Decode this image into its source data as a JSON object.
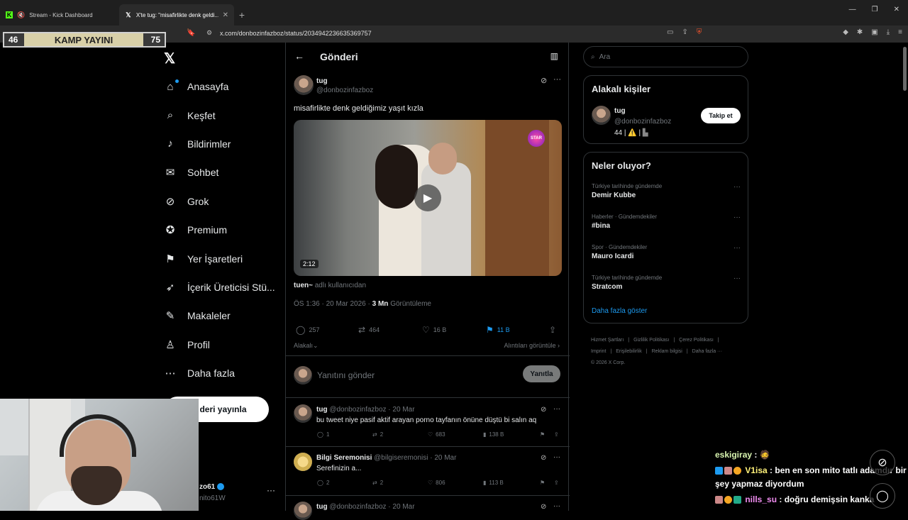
{
  "browser": {
    "tabs": [
      {
        "label": "Stream - Kick Dashboard",
        "active": false
      },
      {
        "label": "X'te tug: \"misafirlikte denk geldi...",
        "active": true
      }
    ],
    "url": "x.com/donbozinfazboz/status/2034942236635369757"
  },
  "overlay": {
    "left": "46",
    "title": "KAMP YAYINI",
    "right": "75"
  },
  "nav": {
    "items": [
      {
        "label": "Anasayfa",
        "icon": "home-icon"
      },
      {
        "label": "Keşfet",
        "icon": "search-icon"
      },
      {
        "label": "Bildirimler",
        "icon": "bell-icon"
      },
      {
        "label": "Sohbet",
        "icon": "mail-icon"
      },
      {
        "label": "Grok",
        "icon": "grok-icon"
      },
      {
        "label": "Premium",
        "icon": "premium-icon"
      },
      {
        "label": "Yer İşaretleri",
        "icon": "bookmark-icon"
      },
      {
        "label": "İçerik Üreticisi Stü...",
        "icon": "rocket-icon"
      },
      {
        "label": "Makaleler",
        "icon": "article-icon"
      },
      {
        "label": "Profil",
        "icon": "user-icon"
      },
      {
        "label": "Daha fazla",
        "icon": "more-icon"
      }
    ],
    "post_button": "deri yayınla",
    "account_name": "zo61",
    "account_handle": "nito61W"
  },
  "main": {
    "header_title": "Gönderi",
    "tweet": {
      "name": "tug",
      "handle": "@donbozinfazboz",
      "text": "misafirlikte denk geldiğimiz yaşıt kızla",
      "duration": "2:12",
      "channel_logo": "STAR",
      "translator": "tuen~",
      "translator_suffix": "adlı kullanıcıdan",
      "time": "ÖS 1:36 · 20 Mar 2026 · ",
      "views": "3 Mn",
      "views_label": "Görüntüleme",
      "replies": "257",
      "retweets": "464",
      "likes": "16 B",
      "bookmarks": "11 B",
      "relevance": "Alakalı",
      "quotes": "Alıntıları görüntüle"
    },
    "reply_placeholder": "Yanıtını gönder",
    "reply_button": "Yanıtla",
    "replies": [
      {
        "name": "tug",
        "meta": "@donbozinfazboz · 20 Mar",
        "text": "bu tweet niye pasif aktif arayan porno tayfanın önüne düştü bi salın aq",
        "replies": "1",
        "retweets": "2",
        "likes": "683",
        "views": "138 B"
      },
      {
        "name": "Bilgi Seremonisi",
        "meta": "@bilgiseremonisi · 20 Mar",
        "text": "Serefinizin a...",
        "replies": "2",
        "retweets": "2",
        "likes": "806",
        "views": "113 B"
      },
      {
        "name": "tug",
        "meta": "@donbozinfazboz · 20 Mar",
        "text": "",
        "replies": "",
        "retweets": "",
        "likes": "",
        "views": ""
      }
    ]
  },
  "right": {
    "search_placeholder": "Ara",
    "related_title": "Alakalı kişiler",
    "related_name": "tug",
    "related_handle": "@donbozinfazboz",
    "related_bio": "44 | ⚠️ | ",
    "follow_label": "Takip et",
    "trends_title": "Neler oluyor?",
    "trends": [
      {
        "context": "Türkiye tarihinde gündemde",
        "name": "Demir Kubbe"
      },
      {
        "context": "Haberler · Gündemdekiler",
        "name": "#bina"
      },
      {
        "context": "Spor · Gündemdekiler",
        "name": "Mauro Icardi"
      },
      {
        "context": "Türkiye tarihinde gündemde",
        "name": "Stratcom"
      }
    ],
    "show_more": "Daha fazla göster",
    "footer": [
      "Hizmet Şartları",
      "|",
      "Gizlilik Politikası",
      "|",
      "Çerez Politikası",
      "|",
      "Imprint",
      "|",
      "Erişilebilirlik",
      "|",
      "Reklam bilgisi",
      "|",
      "Daha fazla ···",
      "© 2026 X Corp."
    ]
  },
  "chat": [
    {
      "user": "eskigiray",
      "text": ""
    },
    {
      "user": "V1isa",
      "text": "ben en son mito tatlı adamdır bir şey yapmaz diyordum"
    },
    {
      "user": "nills_su",
      "text": "doğru demişsin kanka"
    }
  ],
  "colors": {
    "accent": "#1d9bf0",
    "bg": "#000000",
    "muted": "#71767b",
    "brave": "#fb542b"
  }
}
